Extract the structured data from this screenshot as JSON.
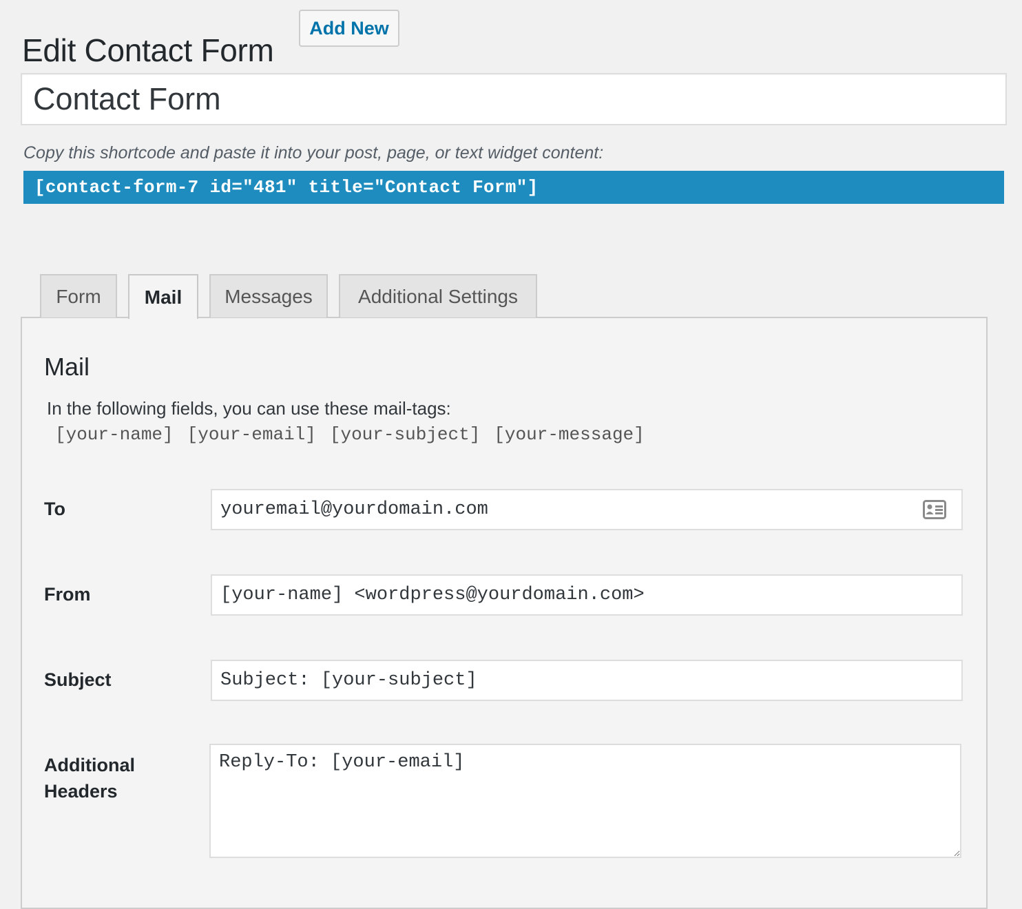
{
  "header": {
    "title": "Edit Contact Form",
    "add_new_label": "Add New"
  },
  "form_title": {
    "value": "Contact Form"
  },
  "shortcode": {
    "label": "Copy this shortcode and paste it into your post, page, or text widget content:",
    "code": "[contact-form-7 id=\"481\" title=\"Contact Form\"]"
  },
  "tabs": [
    {
      "label": "Form",
      "active": false
    },
    {
      "label": "Mail",
      "active": true
    },
    {
      "label": "Messages",
      "active": false
    },
    {
      "label": "Additional Settings",
      "active": false
    }
  ],
  "mail": {
    "heading": "Mail",
    "intro": "In the following fields, you can use these mail-tags:",
    "tags": [
      "[your-name]",
      "[your-email]",
      "[your-subject]",
      "[your-message]"
    ],
    "to": {
      "label": "To",
      "value": "youremail@yourdomain.com",
      "icon": "contact-card-icon"
    },
    "from": {
      "label": "From",
      "value": "[your-name] <wordpress@yourdomain.com>"
    },
    "subject": {
      "label": "Subject",
      "value": "Subject: [your-subject]"
    },
    "additional_headers": {
      "label_line1": "Additional",
      "label_line2": "Headers",
      "value": "Reply-To: [your-email]"
    }
  },
  "colors": {
    "accent": "#0073aa",
    "shortcode_bg": "#1e8cbe",
    "background": "#f1f1f1"
  }
}
